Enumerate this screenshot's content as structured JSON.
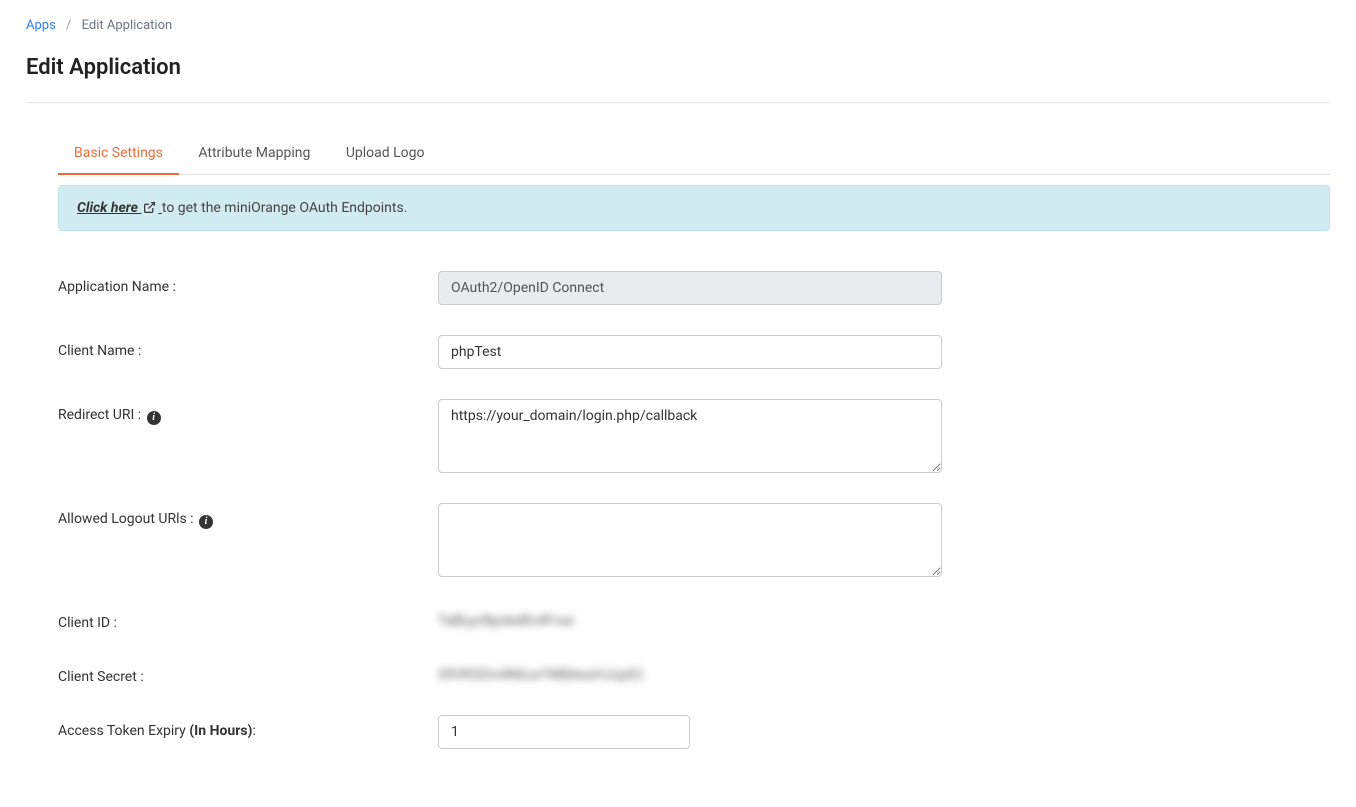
{
  "breadcrumb": {
    "apps_link": "Apps",
    "current": "Edit Application"
  },
  "page_title": "Edit Application",
  "tabs": {
    "basic": "Basic Settings",
    "attribute": "Attribute Mapping",
    "logo": "Upload Logo"
  },
  "info_banner": {
    "click_here": "Click here",
    "rest": " to get the miniOrange OAuth Endpoints."
  },
  "form": {
    "app_name": {
      "label": "Application Name :",
      "value": "OAuth2/OpenID Connect"
    },
    "client_name": {
      "label": "Client Name :",
      "value": "phpTest"
    },
    "redirect_uri": {
      "label": "Redirect URI : ",
      "value": "https://your_domain/login.php/callback"
    },
    "logout_urls": {
      "label": "Allowed Logout URls : ",
      "value": ""
    },
    "client_id": {
      "label": "Client ID :",
      "value": "TaBLycRpokeRc4Fvxe"
    },
    "client_secret": {
      "label": "Client Secret :",
      "value": "S9VR3Zm4NtLw7WBAeuHJcpX2"
    },
    "token_expiry": {
      "label_pre": "Access Token Expiry ",
      "label_bold": "(In Hours)",
      "label_post": ":",
      "value": "1"
    }
  }
}
